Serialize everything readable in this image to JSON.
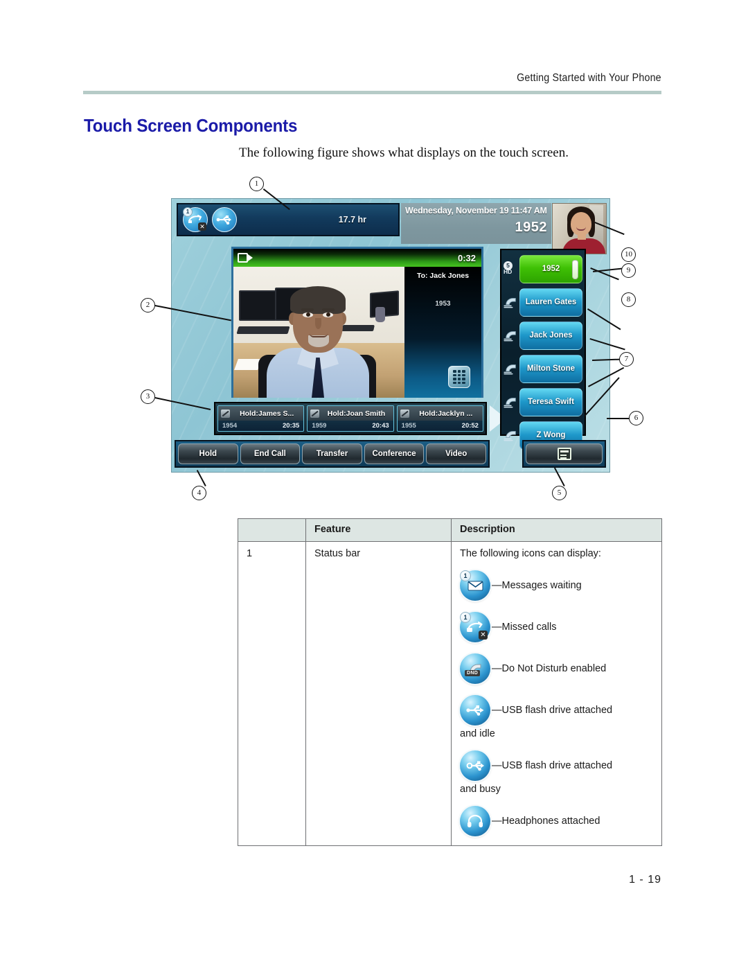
{
  "header": {
    "running_head": "Getting Started with Your Phone"
  },
  "section": {
    "heading": "Touch Screen Components",
    "intro": "The following figure shows what displays on the touch screen."
  },
  "figure": {
    "callouts": [
      "1",
      "2",
      "3",
      "4",
      "5",
      "6",
      "7",
      "8",
      "9",
      "10"
    ],
    "status_bar": {
      "icons": [
        "missed-calls-icon",
        "usb-flash-drive-icon"
      ],
      "missed_calls_count": "1",
      "storage_time": "17.7 hr"
    },
    "date_panel": {
      "datetime": "Wednesday, November 19  11:47 AM",
      "extension": "1952"
    },
    "video_window": {
      "camera_icon": "video-camera-icon",
      "timer": "0:32",
      "near_site_label": "To: Jack Jones",
      "near_site_number": "1953",
      "keypad_icon": "dialpad-icon"
    },
    "hold_calls": [
      {
        "name": "Hold:James S...",
        "number": "1954",
        "duration": "20:35"
      },
      {
        "name": "Hold:Joan Smith",
        "number": "1959",
        "duration": "20:43"
      },
      {
        "name": "Hold:Jacklyn ...",
        "number": "1955",
        "duration": "20:52"
      }
    ],
    "line_keys": [
      {
        "label": "1952",
        "state": "active",
        "icon": "hd-audio-icon",
        "hd_count": "5",
        "hd_text": "HD"
      },
      {
        "label": "Lauren Gates",
        "state": "idle",
        "icon": "handset-icon"
      },
      {
        "label": "Jack Jones",
        "state": "idle",
        "icon": "handset-icon"
      },
      {
        "label": "Milton Stone",
        "state": "idle",
        "icon": "handset-icon"
      },
      {
        "label": "Teresa Swift",
        "state": "idle",
        "icon": "handset-icon"
      },
      {
        "label": "Z Wong",
        "state": "idle",
        "icon": "handset-icon"
      }
    ],
    "soft_keys": [
      "Hold",
      "End Call",
      "Transfer",
      "Conference",
      "Video"
    ],
    "home_key_icon": "home-screen-icon"
  },
  "table": {
    "headers": [
      "",
      "Feature",
      "Description"
    ],
    "rows": [
      {
        "number": "1",
        "feature": "Status bar",
        "description_intro": "The following icons can display:",
        "icons": [
          {
            "icon": "messages-waiting-icon",
            "label": "—Messages waiting",
            "badge": "1",
            "cont": ""
          },
          {
            "icon": "missed-calls-icon",
            "label": "—Missed calls",
            "badge": "1",
            "cont": ""
          },
          {
            "icon": "do-not-disturb-icon",
            "label": "—Do Not Disturb enabled",
            "badge": "",
            "cont": ""
          },
          {
            "icon": "usb-flash-drive-idle-icon",
            "label": "—USB flash drive attached",
            "badge": "",
            "cont": "and idle"
          },
          {
            "icon": "usb-flash-drive-busy-icon",
            "label": "—USB flash drive attached",
            "badge": "",
            "cont": "and busy"
          },
          {
            "icon": "headphones-icon",
            "label": "—Headphones attached",
            "badge": "",
            "cont": ""
          }
        ]
      }
    ]
  },
  "footer": {
    "page_number": "1 - 19"
  }
}
